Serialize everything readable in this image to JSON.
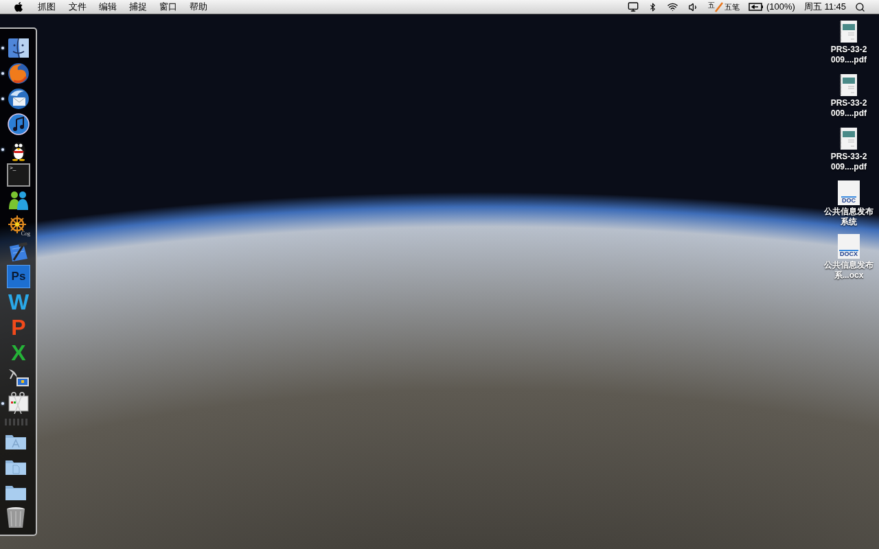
{
  "menu_bar": {
    "app_name": "抓图",
    "menus": [
      "文件",
      "编辑",
      "捕捉",
      "窗口",
      "帮助"
    ],
    "status": {
      "input_method_badge": "五",
      "input_method": "五笔",
      "battery": "(100%)",
      "clock": "周五 11:45"
    }
  },
  "dock": {
    "apps": [
      {
        "kind": "finder",
        "running": true
      },
      {
        "kind": "firefox",
        "running": true
      },
      {
        "kind": "thunderbird",
        "running": true
      },
      {
        "kind": "itunes",
        "running": false
      },
      {
        "kind": "qq",
        "running": true
      },
      {
        "kind": "terminal",
        "running": false,
        "label": ">_"
      },
      {
        "kind": "messenger",
        "running": false
      },
      {
        "kind": "cog",
        "running": false,
        "label": "Cog"
      },
      {
        "kind": "xcode",
        "running": false
      },
      {
        "kind": "photoshop",
        "running": false,
        "label": "Ps"
      },
      {
        "kind": "word",
        "running": false,
        "label": "W"
      },
      {
        "kind": "powerpoint",
        "running": false,
        "label": "P"
      },
      {
        "kind": "excel",
        "running": false,
        "label": "X"
      },
      {
        "kind": "remote",
        "running": false
      },
      {
        "kind": "grab",
        "running": true
      }
    ],
    "stacks": [
      {
        "kind": "apps-folder"
      },
      {
        "kind": "docs-folder"
      },
      {
        "kind": "folder"
      },
      {
        "kind": "trash"
      }
    ]
  },
  "desktop_files": [
    {
      "kind": "pdf",
      "name": "PRS-33-2 009....pdf"
    },
    {
      "kind": "pdf",
      "name": "PRS-33-2 009....pdf"
    },
    {
      "kind": "pdf",
      "name": "PRS-33-2 009....pdf"
    },
    {
      "kind": "doc",
      "badge": "DOC",
      "name": "公共信息发布系统"
    },
    {
      "kind": "doc",
      "badge": "DOCX",
      "name": "公共信息发布系...ocx"
    }
  ]
}
